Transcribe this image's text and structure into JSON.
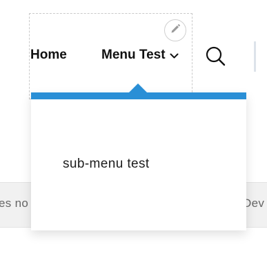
{
  "nav": {
    "items": [
      {
        "label": "Home"
      },
      {
        "label": "Menu Test"
      }
    ],
    "edit_icon": "pencil-icon",
    "search_icon": "search-icon",
    "dropdown_icon": "chevron-down-icon"
  },
  "dropdown": {
    "accent_color": "#2a8fd6",
    "items": [
      {
        "label": "sub-menu test"
      }
    ]
  },
  "background": {
    "left_text": "es no",
    "right_text": "Dev"
  }
}
